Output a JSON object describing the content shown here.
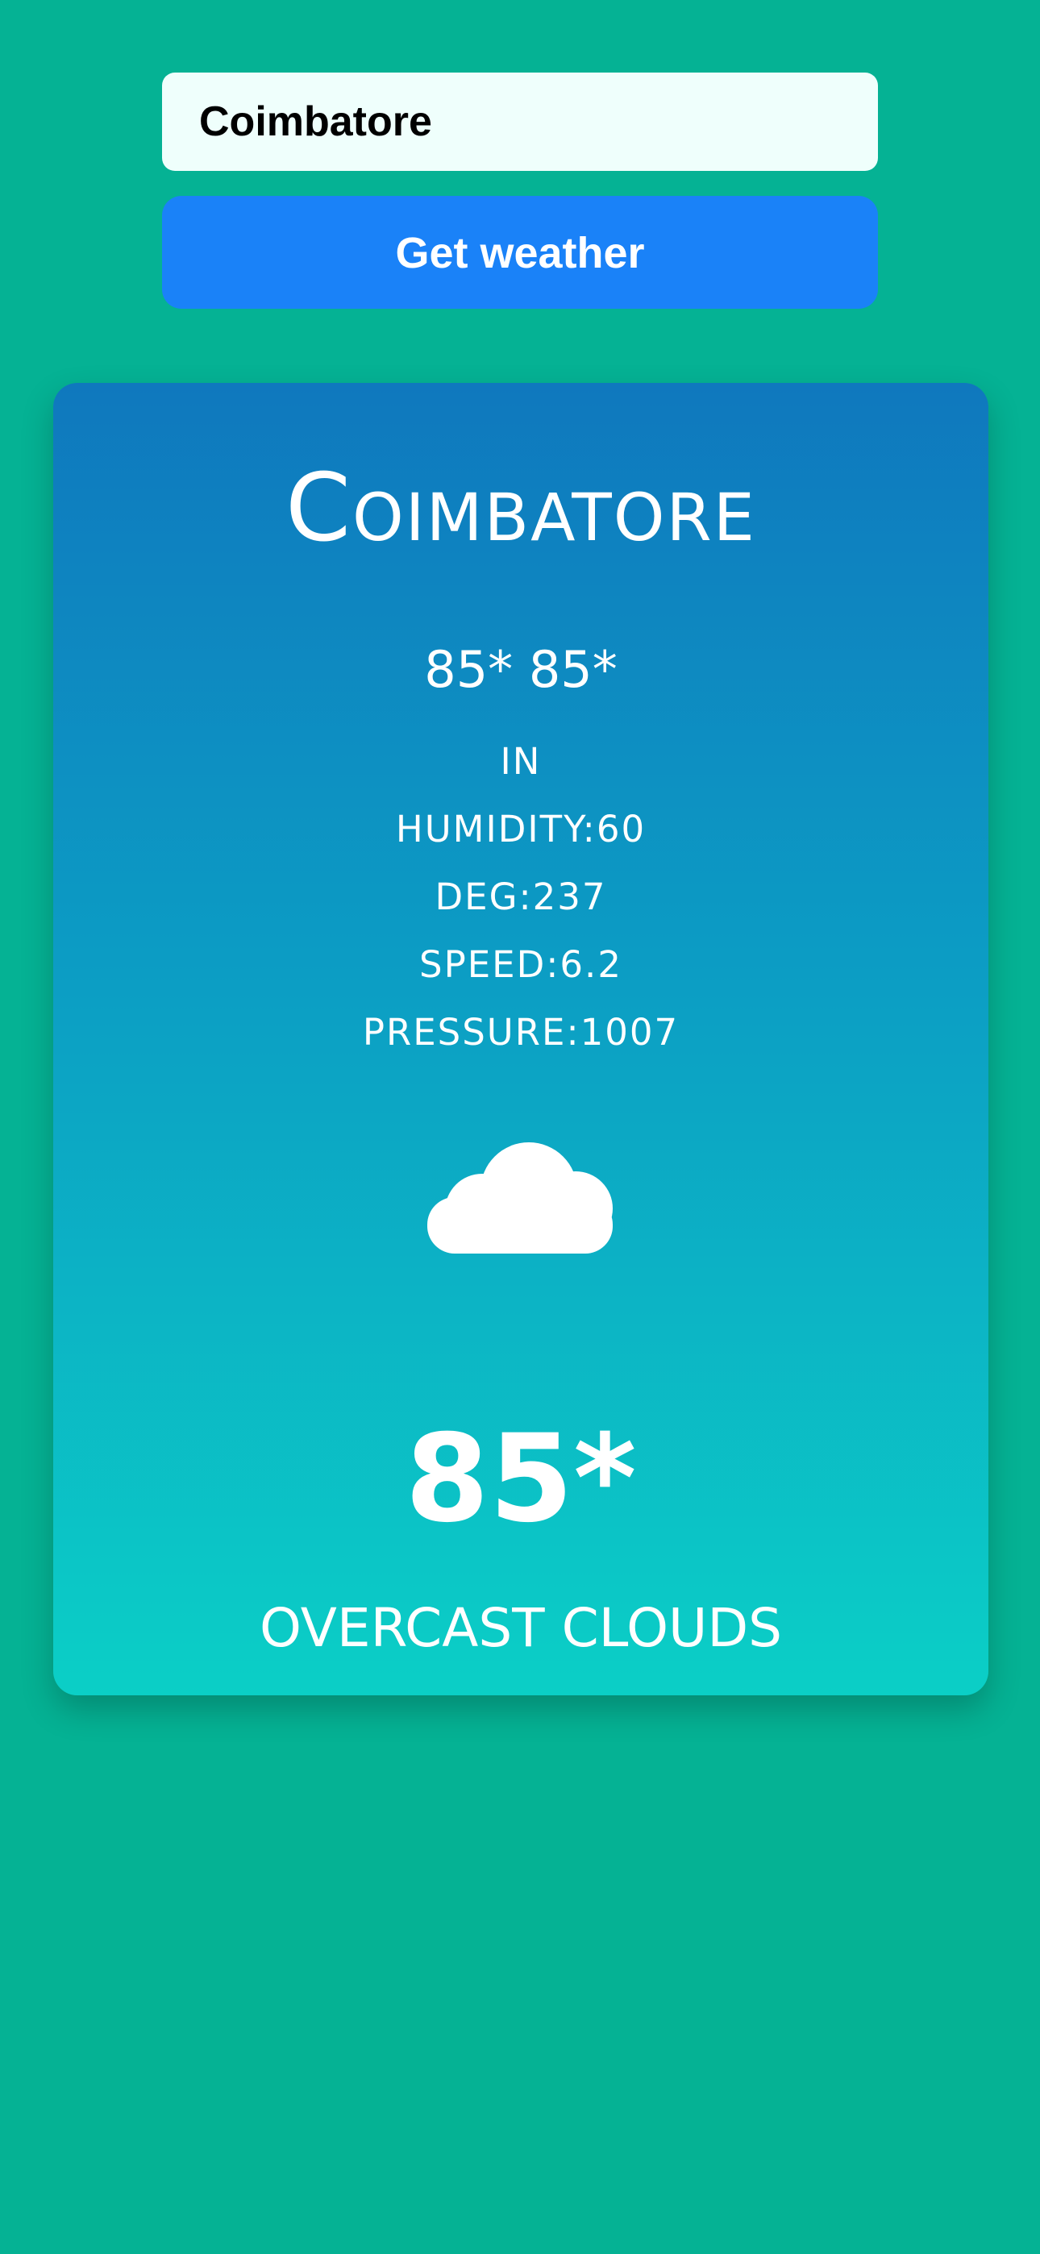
{
  "search": {
    "value": "Coimbatore",
    "button_label": "Get weather"
  },
  "weather": {
    "city": "Coimbatore",
    "min_max": "85* 85*",
    "country": "IN",
    "humidity": "HUMIDITY:60",
    "deg": "DEG:237",
    "speed": "SPEED:6.2",
    "pressure": "PRESSURE:1007",
    "icon": "cloud-icon",
    "temperature": "85*",
    "description": "OVERCAST CLOUDS"
  },
  "colors": {
    "background": "#05b294",
    "input_bg": "#effffc",
    "button": "#1a82f8",
    "card_top": "#0f78be",
    "card_bottom": "#0bcfc6"
  }
}
